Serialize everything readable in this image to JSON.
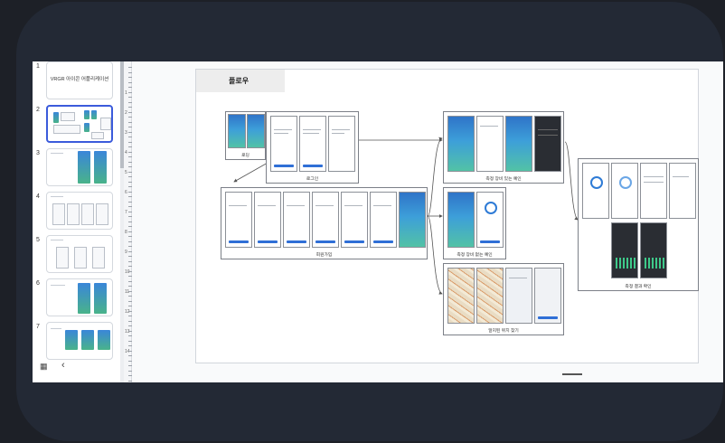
{
  "thumbnails": [
    {
      "num": "1",
      "title": "VRGR 아이콘 어플리케이션"
    },
    {
      "num": "2",
      "title": ""
    },
    {
      "num": "3",
      "title": ""
    },
    {
      "num": "4",
      "title": ""
    },
    {
      "num": "5",
      "title": ""
    },
    {
      "num": "6",
      "title": ""
    },
    {
      "num": "7",
      "title": ""
    }
  ],
  "selected_thumbnail": "2",
  "footer": {
    "grid_icon": "grid-view-icon",
    "collapse_icon": "chevron-left-icon",
    "grid_glyph": "▦",
    "collapse_glyph": "‹"
  },
  "ruler_numbers": [
    "1",
    "2",
    "3",
    "4",
    "5",
    "6",
    "7",
    "8",
    "9",
    "10",
    "11",
    "12",
    "13",
    "14"
  ],
  "slide": {
    "title": "플로우",
    "groups": {
      "splash": "로딩",
      "login": "로그인",
      "signup": "회원가입",
      "measure_with_device": "측정 장비 있는 예인",
      "measure_without_device": "측정 장비 없는 예인",
      "find_location": "알지된 위치 찾기",
      "result": "측정 결과 확인"
    }
  },
  "colors": {
    "device": "#232935",
    "accent": "#2f6fd6",
    "selection": "#3b5bdb",
    "background": "#1d2027"
  }
}
